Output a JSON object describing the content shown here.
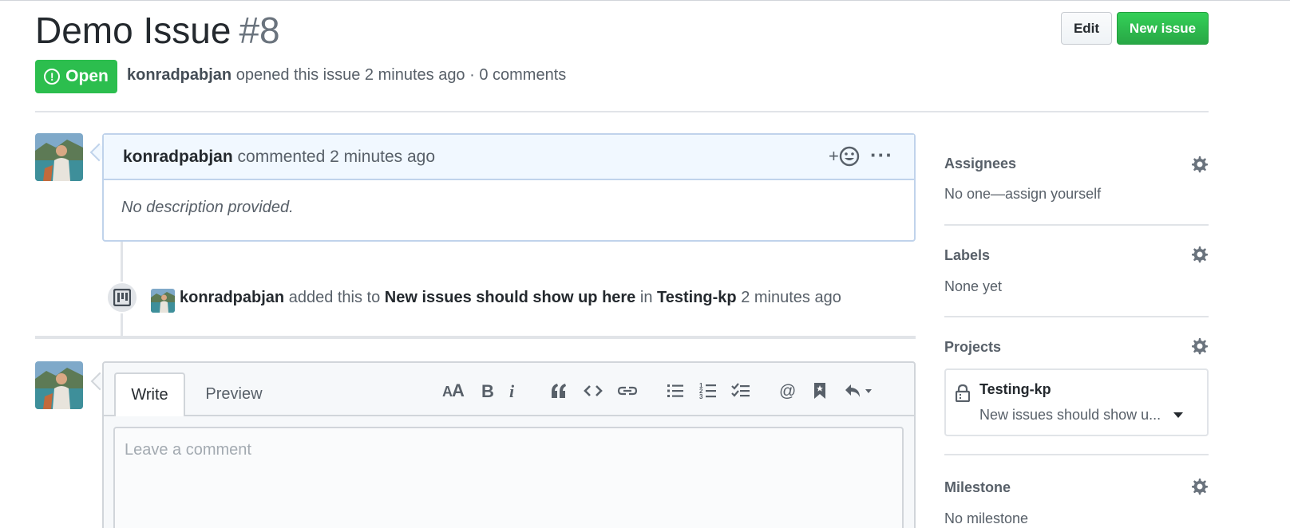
{
  "issue": {
    "title": "Demo Issue",
    "number": "#8",
    "state": "Open",
    "author": "konradpabjan",
    "opened_text": "opened this issue 2 minutes ago · 0 comments"
  },
  "header_buttons": {
    "edit": "Edit",
    "new_issue": "New issue"
  },
  "comment": {
    "author": "konradpabjan",
    "meta": "commented 2 minutes ago",
    "body": "No description provided.",
    "reaction_plus": "+",
    "more": "···"
  },
  "event": {
    "actor": "konradpabjan",
    "verb": "added this to",
    "column": "New issues should show up here",
    "preposition": "in",
    "project": "Testing-kp",
    "time": "2 minutes ago"
  },
  "editor": {
    "tabs": [
      "Write",
      "Preview"
    ],
    "active_tab": "Write",
    "placeholder": "Leave a comment",
    "toolbar": [
      "heading-icon",
      "bold-icon",
      "italic-icon",
      "quote-icon",
      "code-icon",
      "link-icon",
      "unordered-list-icon",
      "ordered-list-icon",
      "task-list-icon",
      "mention-icon",
      "bookmark-icon",
      "reply-icon"
    ]
  },
  "sidebar": {
    "assignees": {
      "title": "Assignees",
      "value": "No one—assign yourself"
    },
    "labels": {
      "title": "Labels",
      "value": "None yet"
    },
    "projects": {
      "title": "Projects",
      "project_name": "Testing-kp",
      "project_column": "New issues should show u..."
    },
    "milestone": {
      "title": "Milestone",
      "value": "No milestone"
    }
  },
  "colors": {
    "open_green": "#2cbe4e",
    "comment_header_bg": "#f1f8ff",
    "comment_border": "#c0d3eb",
    "text_muted": "#586069"
  }
}
